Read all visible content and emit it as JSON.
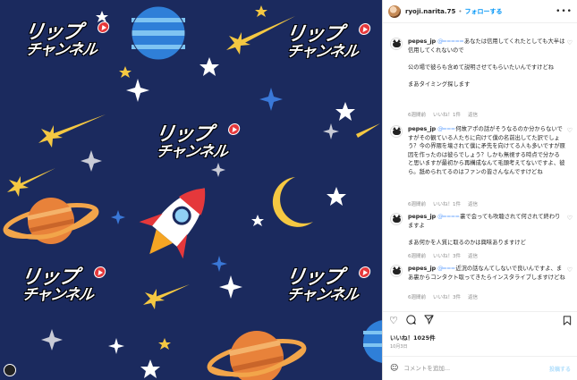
{
  "post": {
    "image": {
      "logo_line1": "リップ",
      "logo_line2": "チャンネル"
    }
  },
  "header": {
    "username": "ryoji.narita.75",
    "separator": "•",
    "follow_label": "フォローする",
    "more_icon": "more-horizontal-icon"
  },
  "comments": [
    {
      "user": "pepes_jp",
      "redacted": "@═ ═ ═ ═ ═ ",
      "text": "あなたは信用してくれたとしても大半は信用してくれないので\n\n公の場で彼らも含めて説明させてもらいたいんですけどね\n\nまあタイミング探します",
      "time": "6週間前",
      "likes": "いいね！1件",
      "reply": "返信"
    },
    {
      "user": "pepes_jp",
      "redacted": "@═ ═ ═ ",
      "text": "何故アポの話がそうなるのか分からないですがその観ている人たちに向けて僕の名前出してた訳でしょう？今の界隈を壊されて僕に矛先を向けてる人も多いですが原因を作ったのは彼らでしょう？しかも無視する時点で分かると思いますが最初から再構成なんて毛頭考えてないですよ、彼ら。舐められてるのはファンの皆さんなんですけどね",
      "time": "6週間前",
      "likes": "いいね！1件",
      "reply": "返信"
    },
    {
      "user": "pepes_jp",
      "redacted": "@═ ═ ═ ═ ",
      "text": "裏で会っても吹聴されて何されて終わりますよ\n\nまあ何かを人質に取るのかは興味ありますけど",
      "time": "6週間前",
      "likes": "いいね！3件",
      "reply": "返信"
    },
    {
      "user": "pepes_jp",
      "redacted": "@═ ═ ═ ",
      "text": "近況の話なんてしないで良いんですよ、まあ裏からコンタクト取ってきたらインスタライブしますけどね",
      "time": "6週間前",
      "likes": "いいね！3件",
      "reply": "返信"
    }
  ],
  "actions": {
    "like_icon": "heart-icon",
    "comment_icon": "comment-icon",
    "share_icon": "share-icon",
    "save_icon": "bookmark-icon"
  },
  "likes_count": "いいね！1025件",
  "date": "10月3日",
  "add_comment": {
    "emoji_icon": "smile-icon",
    "placeholder": "コメントを追加...",
    "post_label": "投稿する"
  },
  "colors": {
    "background": "#1b2a5e",
    "accent": "#0095f6",
    "logo_red": "#e5383b"
  }
}
